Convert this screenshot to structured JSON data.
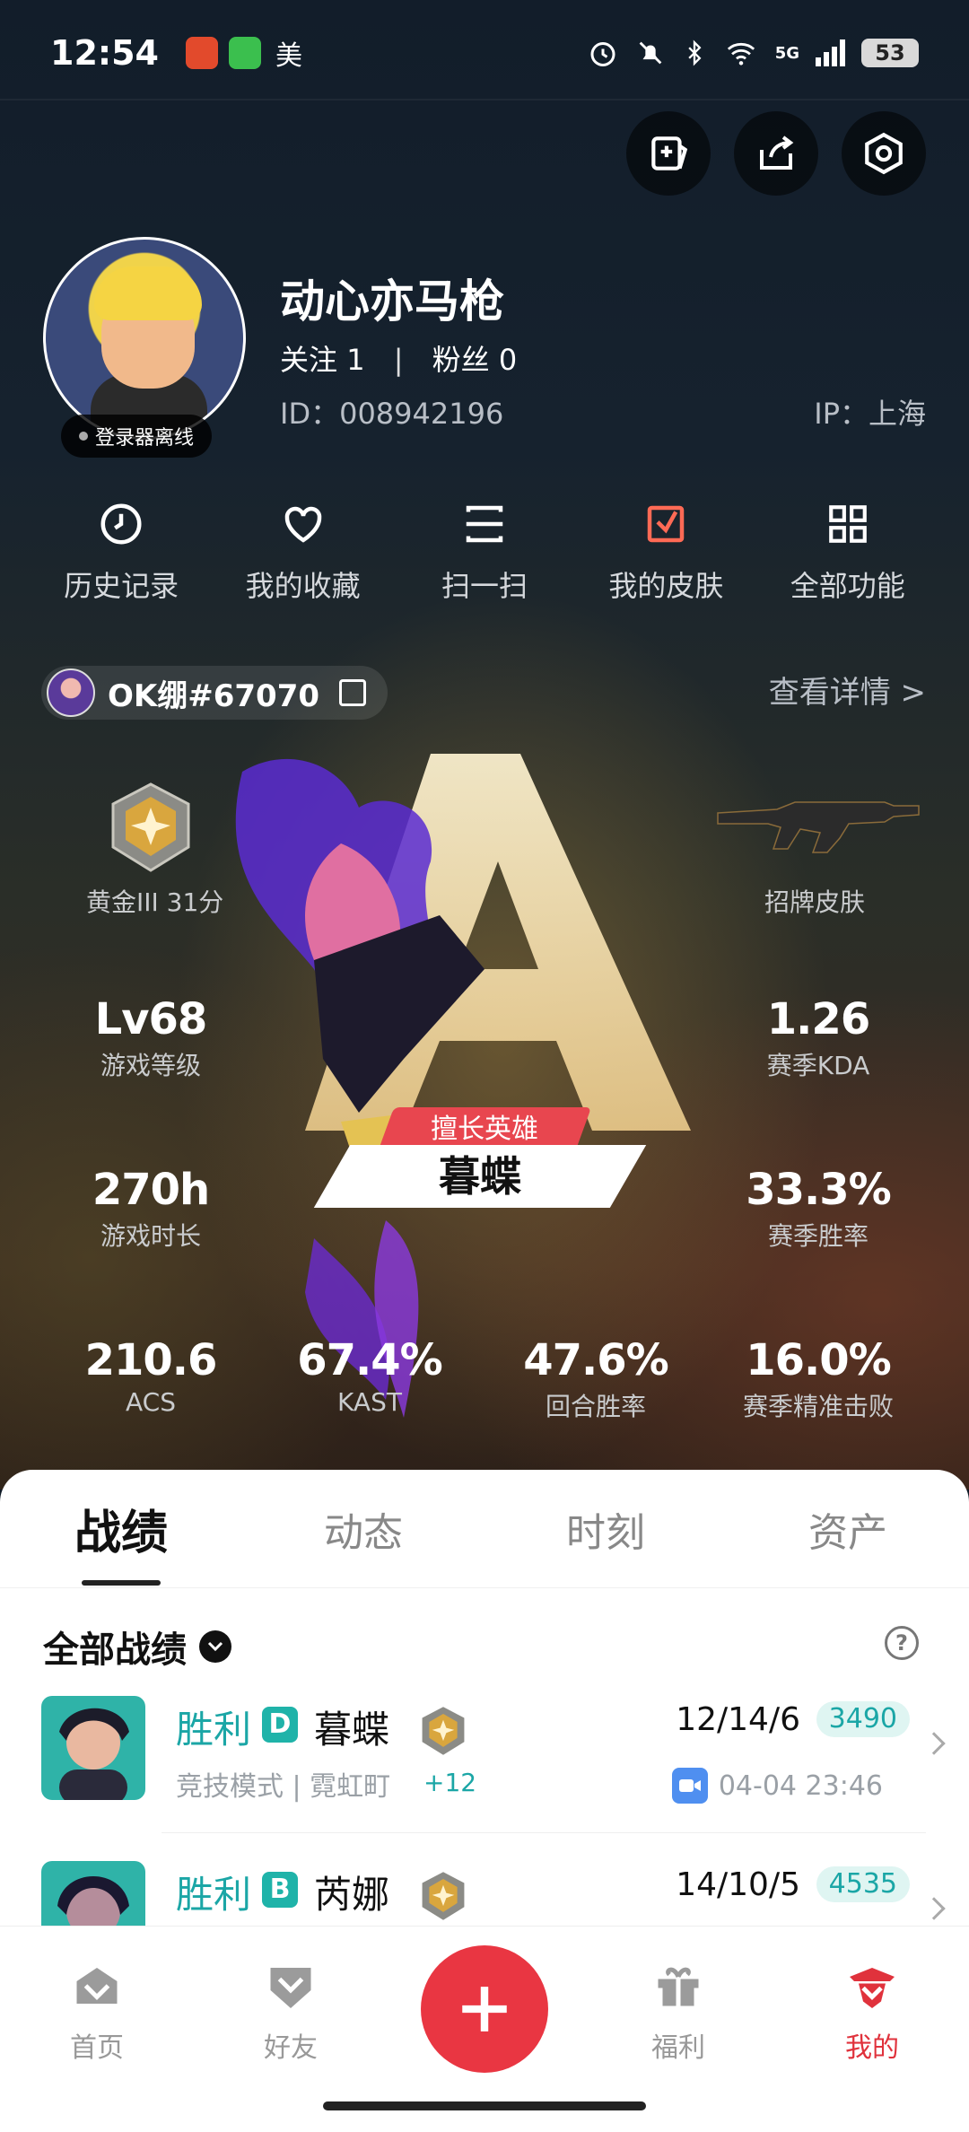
{
  "status_bar": {
    "time": "12:54",
    "app_label": "美",
    "network": "5G",
    "battery": "53"
  },
  "profile": {
    "username": "动心亦马枪",
    "follow_label": "关注",
    "follow_count": "1",
    "fans_label": "粉丝",
    "fans_count": "0",
    "separator": "|",
    "id_text": "ID：008942196",
    "ip_text": "IP：上海",
    "offline_tag": "登录器离线"
  },
  "quick_menu": [
    {
      "label": "历史记录",
      "icon": "history-icon"
    },
    {
      "label": "我的收藏",
      "icon": "heart-icon"
    },
    {
      "label": "扫一扫",
      "icon": "scan-icon"
    },
    {
      "label": "我的皮肤",
      "icon": "skin-icon"
    },
    {
      "label": "全部功能",
      "icon": "grid-icon"
    }
  ],
  "game_account": {
    "name": "OK绷#67070",
    "view_detail": "查看详情 >"
  },
  "stats": {
    "rank": "黄金III 31分",
    "signature_skin": "招牌皮肤",
    "level_value": "Lv68",
    "level_label": "游戏等级",
    "kda_value": "1.26",
    "kda_label": "赛季KDA",
    "hours_value": "270h",
    "hours_label": "游戏时长",
    "winrate_value": "33.3%",
    "winrate_label": "赛季胜率",
    "acs_value": "210.6",
    "acs_label": "ACS",
    "kast_value": "67.4%",
    "kast_label": "KAST",
    "round_value": "47.6%",
    "round_label": "回合胜率",
    "precision_value": "16.0%",
    "precision_label": "赛季精准击败",
    "best_hero_tag": "擅长英雄",
    "best_hero_name": "暮蝶",
    "grade_letter": "A"
  },
  "tabs": [
    {
      "label": "战绩",
      "active": true
    },
    {
      "label": "动态",
      "active": false
    },
    {
      "label": "时刻",
      "active": false
    },
    {
      "label": "资产",
      "active": false
    }
  ],
  "records": {
    "section_title": "全部战绩",
    "matches": [
      {
        "result": "胜利",
        "grade": "D",
        "agent": "暮蝶",
        "mode": "竞技模式 | 霓虹町",
        "delta": "+12",
        "kda": "12/14/6",
        "score": "3490",
        "datetime": "04-04 23:46"
      },
      {
        "result": "胜利",
        "grade": "B",
        "agent": "芮娜",
        "kda": "14/10/5",
        "score": "4535"
      }
    ]
  },
  "bottom_nav": [
    {
      "label": "首页",
      "icon": "home-icon",
      "active": false
    },
    {
      "label": "好友",
      "icon": "friends-icon",
      "active": false
    },
    {
      "label": "福利",
      "icon": "gift-icon",
      "active": false
    },
    {
      "label": "我的",
      "icon": "profile-icon",
      "active": true
    }
  ],
  "colors": {
    "accent_red": "#e93642",
    "win_teal": "#1ba6a6",
    "hero_bg_top": "#121d2a"
  }
}
